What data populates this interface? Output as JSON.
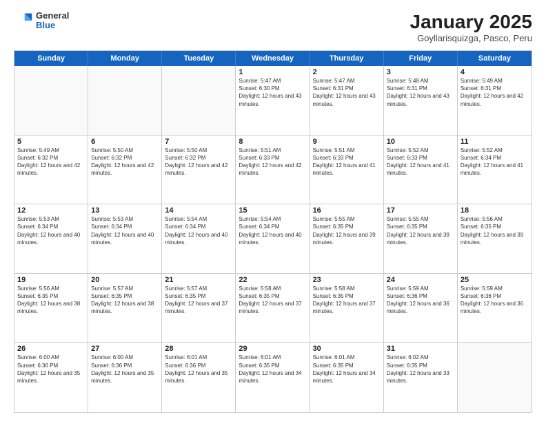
{
  "header": {
    "logo": {
      "general": "General",
      "blue": "Blue"
    },
    "title": "January 2025",
    "location": "Goyllarisquizga, Pasco, Peru"
  },
  "weekdays": [
    "Sunday",
    "Monday",
    "Tuesday",
    "Wednesday",
    "Thursday",
    "Friday",
    "Saturday"
  ],
  "weeks": [
    [
      {
        "day": "",
        "sunrise": "",
        "sunset": "",
        "daylight": ""
      },
      {
        "day": "",
        "sunrise": "",
        "sunset": "",
        "daylight": ""
      },
      {
        "day": "",
        "sunrise": "",
        "sunset": "",
        "daylight": ""
      },
      {
        "day": "1",
        "sunrise": "Sunrise: 5:47 AM",
        "sunset": "Sunset: 6:30 PM",
        "daylight": "Daylight: 12 hours and 43 minutes."
      },
      {
        "day": "2",
        "sunrise": "Sunrise: 5:47 AM",
        "sunset": "Sunset: 6:31 PM",
        "daylight": "Daylight: 12 hours and 43 minutes."
      },
      {
        "day": "3",
        "sunrise": "Sunrise: 5:48 AM",
        "sunset": "Sunset: 6:31 PM",
        "daylight": "Daylight: 12 hours and 43 minutes."
      },
      {
        "day": "4",
        "sunrise": "Sunrise: 5:49 AM",
        "sunset": "Sunset: 6:31 PM",
        "daylight": "Daylight: 12 hours and 42 minutes."
      }
    ],
    [
      {
        "day": "5",
        "sunrise": "Sunrise: 5:49 AM",
        "sunset": "Sunset: 6:32 PM",
        "daylight": "Daylight: 12 hours and 42 minutes."
      },
      {
        "day": "6",
        "sunrise": "Sunrise: 5:50 AM",
        "sunset": "Sunset: 6:32 PM",
        "daylight": "Daylight: 12 hours and 42 minutes."
      },
      {
        "day": "7",
        "sunrise": "Sunrise: 5:50 AM",
        "sunset": "Sunset: 6:32 PM",
        "daylight": "Daylight: 12 hours and 42 minutes."
      },
      {
        "day": "8",
        "sunrise": "Sunrise: 5:51 AM",
        "sunset": "Sunset: 6:33 PM",
        "daylight": "Daylight: 12 hours and 42 minutes."
      },
      {
        "day": "9",
        "sunrise": "Sunrise: 5:51 AM",
        "sunset": "Sunset: 6:33 PM",
        "daylight": "Daylight: 12 hours and 41 minutes."
      },
      {
        "day": "10",
        "sunrise": "Sunrise: 5:52 AM",
        "sunset": "Sunset: 6:33 PM",
        "daylight": "Daylight: 12 hours and 41 minutes."
      },
      {
        "day": "11",
        "sunrise": "Sunrise: 5:52 AM",
        "sunset": "Sunset: 6:34 PM",
        "daylight": "Daylight: 12 hours and 41 minutes."
      }
    ],
    [
      {
        "day": "12",
        "sunrise": "Sunrise: 5:53 AM",
        "sunset": "Sunset: 6:34 PM",
        "daylight": "Daylight: 12 hours and 40 minutes."
      },
      {
        "day": "13",
        "sunrise": "Sunrise: 5:53 AM",
        "sunset": "Sunset: 6:34 PM",
        "daylight": "Daylight: 12 hours and 40 minutes."
      },
      {
        "day": "14",
        "sunrise": "Sunrise: 5:54 AM",
        "sunset": "Sunset: 6:34 PM",
        "daylight": "Daylight: 12 hours and 40 minutes."
      },
      {
        "day": "15",
        "sunrise": "Sunrise: 5:54 AM",
        "sunset": "Sunset: 6:34 PM",
        "daylight": "Daylight: 12 hours and 40 minutes."
      },
      {
        "day": "16",
        "sunrise": "Sunrise: 5:55 AM",
        "sunset": "Sunset: 6:35 PM",
        "daylight": "Daylight: 12 hours and 39 minutes."
      },
      {
        "day": "17",
        "sunrise": "Sunrise: 5:55 AM",
        "sunset": "Sunset: 6:35 PM",
        "daylight": "Daylight: 12 hours and 39 minutes."
      },
      {
        "day": "18",
        "sunrise": "Sunrise: 5:56 AM",
        "sunset": "Sunset: 6:35 PM",
        "daylight": "Daylight: 12 hours and 39 minutes."
      }
    ],
    [
      {
        "day": "19",
        "sunrise": "Sunrise: 5:56 AM",
        "sunset": "Sunset: 6:35 PM",
        "daylight": "Daylight: 12 hours and 38 minutes."
      },
      {
        "day": "20",
        "sunrise": "Sunrise: 5:57 AM",
        "sunset": "Sunset: 6:35 PM",
        "daylight": "Daylight: 12 hours and 38 minutes."
      },
      {
        "day": "21",
        "sunrise": "Sunrise: 5:57 AM",
        "sunset": "Sunset: 6:35 PM",
        "daylight": "Daylight: 12 hours and 37 minutes."
      },
      {
        "day": "22",
        "sunrise": "Sunrise: 5:58 AM",
        "sunset": "Sunset: 6:35 PM",
        "daylight": "Daylight: 12 hours and 37 minutes."
      },
      {
        "day": "23",
        "sunrise": "Sunrise: 5:58 AM",
        "sunset": "Sunset: 6:35 PM",
        "daylight": "Daylight: 12 hours and 37 minutes."
      },
      {
        "day": "24",
        "sunrise": "Sunrise: 5:59 AM",
        "sunset": "Sunset: 6:36 PM",
        "daylight": "Daylight: 12 hours and 36 minutes."
      },
      {
        "day": "25",
        "sunrise": "Sunrise: 5:59 AM",
        "sunset": "Sunset: 6:36 PM",
        "daylight": "Daylight: 12 hours and 36 minutes."
      }
    ],
    [
      {
        "day": "26",
        "sunrise": "Sunrise: 6:00 AM",
        "sunset": "Sunset: 6:36 PM",
        "daylight": "Daylight: 12 hours and 35 minutes."
      },
      {
        "day": "27",
        "sunrise": "Sunrise: 6:00 AM",
        "sunset": "Sunset: 6:36 PM",
        "daylight": "Daylight: 12 hours and 35 minutes."
      },
      {
        "day": "28",
        "sunrise": "Sunrise: 6:01 AM",
        "sunset": "Sunset: 6:36 PM",
        "daylight": "Daylight: 12 hours and 35 minutes."
      },
      {
        "day": "29",
        "sunrise": "Sunrise: 6:01 AM",
        "sunset": "Sunset: 6:35 PM",
        "daylight": "Daylight: 12 hours and 34 minutes."
      },
      {
        "day": "30",
        "sunrise": "Sunrise: 6:01 AM",
        "sunset": "Sunset: 6:35 PM",
        "daylight": "Daylight: 12 hours and 34 minutes."
      },
      {
        "day": "31",
        "sunrise": "Sunrise: 6:02 AM",
        "sunset": "Sunset: 6:35 PM",
        "daylight": "Daylight: 12 hours and 33 minutes."
      },
      {
        "day": "",
        "sunrise": "",
        "sunset": "",
        "daylight": ""
      }
    ]
  ]
}
